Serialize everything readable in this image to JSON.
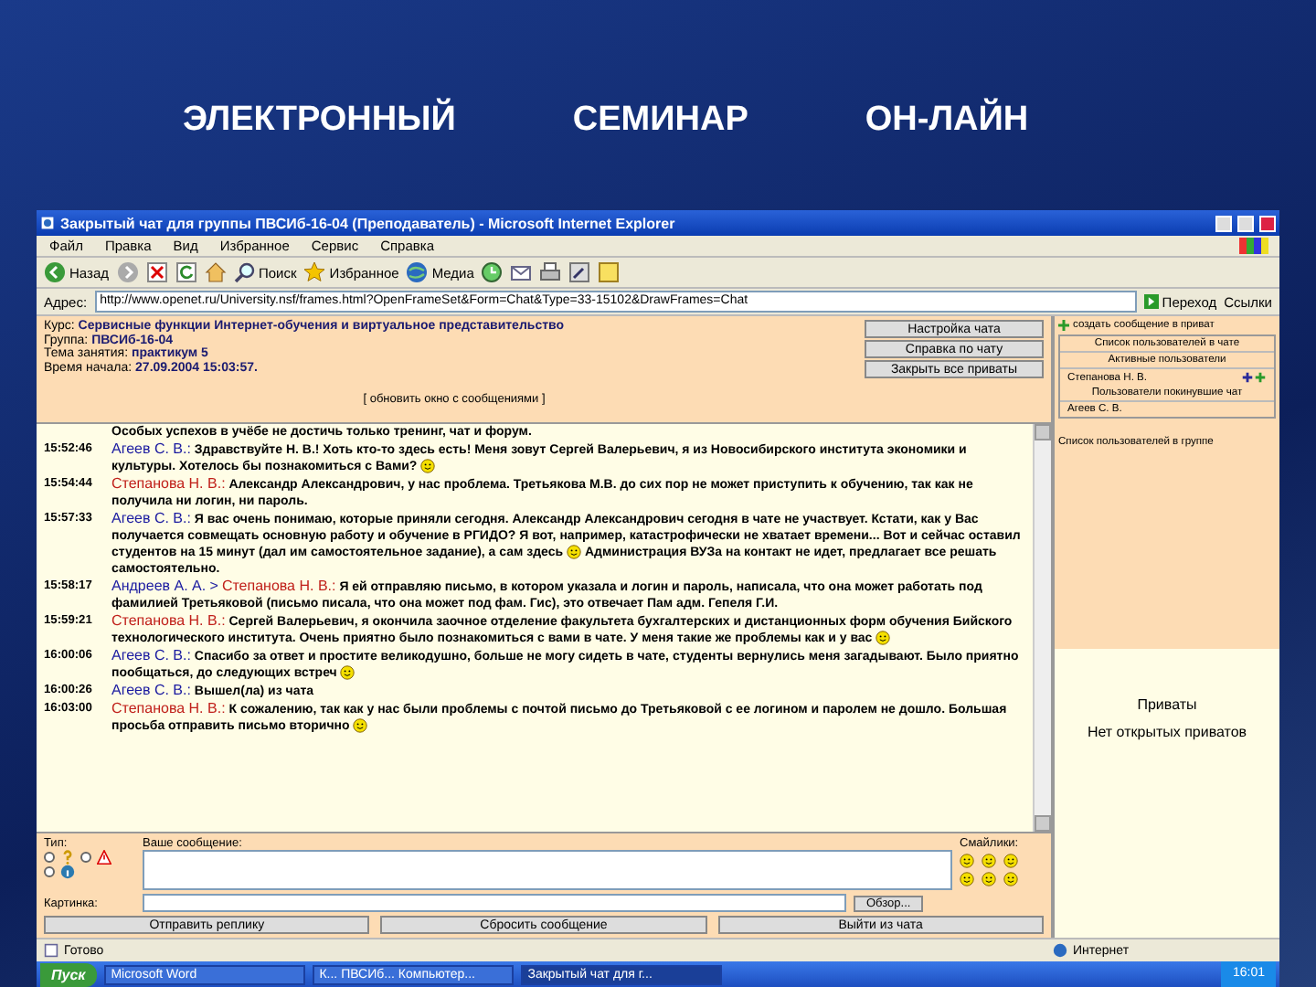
{
  "slide_title": [
    "ЭЛЕКТРОННЫЙ",
    "СЕМИНАР",
    "ОН-ЛАЙН"
  ],
  "window": {
    "title": "Закрытый чат для группы ПВСИб-16-04 (Преподаватель) - Microsoft Internet Explorer"
  },
  "menu": [
    "Файл",
    "Правка",
    "Вид",
    "Избранное",
    "Сервис",
    "Справка"
  ],
  "toolbar": [
    {
      "kind": "back",
      "label": "Назад"
    },
    {
      "kind": "forward"
    },
    {
      "kind": "stop"
    },
    {
      "kind": "refresh"
    },
    {
      "kind": "home"
    },
    {
      "kind": "search",
      "label": "Поиск"
    },
    {
      "kind": "favorites",
      "label": "Избранное"
    },
    {
      "kind": "media",
      "label": "Медиа"
    },
    {
      "kind": "history"
    },
    {
      "kind": "mail"
    },
    {
      "kind": "print"
    },
    {
      "kind": "edit"
    },
    {
      "kind": "note"
    }
  ],
  "address": {
    "label": "Адрес:",
    "value": "http://www.openet.ru/University.nsf/frames.html?OpenFrameSet&Form=Chat&Type=33-15102&DrawFrames=Chat",
    "go": "Переход",
    "links": "Ссылки"
  },
  "course_info": [
    {
      "label": "Курс:",
      "value": "Сервисные функции Интернет-обучения и виртуальное представительство"
    },
    {
      "label": "Группа:",
      "value": "ПВСИб-16-04"
    },
    {
      "label": "Тема занятия:",
      "value": "практикум 5"
    },
    {
      "label": "Время начала:",
      "value": "27.09.2004 15:03:57."
    }
  ],
  "refresh_link": "[ обновить окно с сообщениями ]",
  "header_buttons": [
    "Настройка чата",
    "Справка по чату",
    "Закрыть все приваты"
  ],
  "messages": [
    {
      "text": "Особых успехов в учёбе не достичь только тренинг, чат и форум.",
      "smiley": false
    },
    {
      "time": "15:52:46",
      "author": "Агеев С. В.:",
      "color": "#1a1aa0",
      "text": "Здравствуйте Н. В.! Хоть кто-то здесь есть! Меня зовут Сергей Валерьевич, я из Новосибирского института экономики и культуры. Хотелось бы познакомиться с Вами?",
      "smiley": true
    },
    {
      "time": "15:54:44",
      "author": "Степанова Н. В.:",
      "color": "#c0201a",
      "text": "Александр Александрович, у нас проблема. Третьякова М.В. до сих пор не может приступить к обучению, так как не получила ни логин, ни пароль.",
      "smiley": false
    },
    {
      "time": "15:57:33",
      "author": "Агеев С. В.:",
      "color": "#1a1aa0",
      "text": "Я вас очень понимаю, которые приняли сегодня. Александр Александрович сегодня в чате не участвует. Кстати, как у Вас получается совмещать основную работу и обучение в РГИДО? Я вот, например, катастрофически не хватает времени... Вот и сейчас оставил студентов на 15 минут (дал им самостоятельное задание), а сам здесь",
      "smiley": true,
      "after": "Администрация ВУЗа на контакт не идет, предлагает все решать самостоятельно."
    },
    {
      "time": "15:58:17",
      "author": "Андреев А. А. >",
      "color": "#1a1aa0",
      "to": {
        "name": "Степанова Н. В.:",
        "color": "#c0201a"
      },
      "text": "Я ей отправляю письмо, в котором указала и логин и пароль, написала, что она может работать под фамилией Третьяковой (письмо писала, что она может под фам. Гис), это отвечает Пам адм. Гепеля Г.И.",
      "smiley": false
    },
    {
      "time": "15:59:21",
      "author": "Степанова Н. В.:",
      "color": "#c0201a",
      "text": "Сергей Валерьевич, я окончила заочное отделение факультета бухгалтерских и дистанционных форм обучения Бийского технологического института. Очень приятно было познакомиться с вами в чате. У меня такие же проблемы как и у вас",
      "smiley": true
    },
    {
      "time": "16:00:06",
      "author": "Агеев С. В.:",
      "color": "#1a1aa0",
      "text": "Спасибо за ответ и простите великодушно, больше не могу сидеть в чате, студенты вернулись меня загадывают. Было приятно пообщаться, до следующих встреч",
      "smiley": true
    },
    {
      "time": "16:00:26",
      "author": "Агеев С. В.:",
      "color": "#1a1aa0",
      "text": "Вышел(ла) из чата",
      "smiley": false
    },
    {
      "time": "16:03:00",
      "author": "Степанова Н. В.:",
      "color": "#c0201a",
      "text": "К сожалению, так как у нас были проблемы с почтой письмо до Третьяковой с ее логином и паролем не дошло. Большая просьба отправить письмо вторично",
      "smiley": true
    }
  ],
  "form": {
    "type_label": "Тип:",
    "types": [
      {
        "kind": "question",
        "selected": false
      },
      {
        "kind": "warning",
        "selected": false
      },
      {
        "kind": "info",
        "selected": false
      }
    ],
    "message_label": "Ваше сообщение:",
    "smileys_label": "Смайлики:",
    "picture_label": "Картинка:",
    "browse": "Обзор...",
    "buttons": [
      "Отправить реплику",
      "Сбросить сообщение",
      "Выйти из чата"
    ]
  },
  "side": {
    "create_private": "создать сообщение в приват",
    "users_title": "Список пользователей в чате",
    "active_title": "Активные пользователи",
    "active": [
      "Степанова Н. В."
    ],
    "left_title": "Пользователи покинувшие чат",
    "left": [
      "Агеев С. В."
    ],
    "group_link": "Список пользователей в группе",
    "privates_title": "Приваты",
    "privates_empty": "Нет открытых приватов"
  },
  "status_bar": {
    "text": "Готово",
    "zone": "Интернет"
  },
  "taskbar": {
    "start": "Пуск",
    "tasks": [
      {
        "label": "Microsoft Word",
        "selected": false
      },
      {
        "label": "К... ПВСИб... Компьютер...",
        "selected": false
      },
      {
        "label": "Закрытый чат для г...",
        "selected": true
      }
    ],
    "clock": "16:01"
  }
}
